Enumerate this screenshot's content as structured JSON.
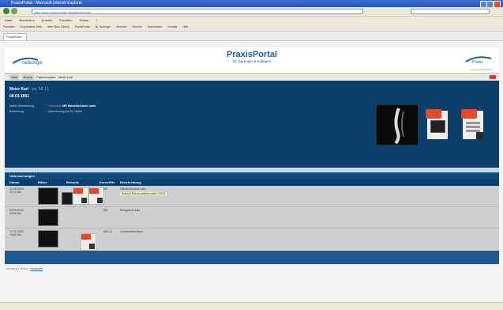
{
  "browser": {
    "title": "PraxisPortal - Microsoft Internet Explorer",
    "address": "http://www.praxisportal.de/patientenakte",
    "menu": [
      "Datei",
      "Bearbeiten",
      "Ansicht",
      "Favoriten",
      "Extras",
      "?"
    ],
    "favorites": [
      "Favoriten",
      "Empfohlene Sites",
      "Web Slice Gallery",
      "PraxisPortal",
      "Dr. Sprenger",
      "Befunde",
      "Termine",
      "Nachrichten",
      "Kontakt",
      "Hilfe"
    ],
    "tab_label": "PraxisPortal"
  },
  "header": {
    "logo_left": "radiologie",
    "title": "PraxisPortal",
    "subtitle": "Dr. Sprenger & Kollegen",
    "logo_right": "Praxis",
    "subline": "Gemeinschaftspraxis"
  },
  "breadcrumb": {
    "items": [
      "Start",
      "Suche"
    ],
    "current": "Patientenakte - Meier Karl"
  },
  "patient": {
    "name": "Meier Karl",
    "name_extra": "(m, 58 J.)",
    "dob": "08.03.1951",
    "rows": [
      {
        "label": "Aktive Überweisung",
        "red": "Orthopädie",
        "strong": "MR Halswirbelsäule nativ"
      },
      {
        "label": "Bemerkung",
        "red": "",
        "strong": "",
        "text": "Überweisung von Dr. Huber"
      }
    ]
  },
  "studies": {
    "section_title": "Untersuchungen",
    "columns": [
      "Datum",
      "Bilder",
      "Befunde",
      "Kennziffer",
      "Beschreibung"
    ],
    "rows": [
      {
        "date": "12.05.2009",
        "time": "10:14 Uhr",
        "code": "MR",
        "desc": "Halswirbelsäule nativ",
        "desc2": "Befund: Bandscheibenvorfall C5/C6",
        "icons": 2
      },
      {
        "date": "03.04.2009",
        "time": "08:30 Uhr",
        "code": "MR",
        "desc": "Kniegelenk links",
        "desc2": "",
        "icons": 0
      },
      {
        "date": "17.02.2009",
        "time": "14:05 Uhr",
        "code": "MR LS",
        "desc": "Lendenwirbelsäule",
        "desc2": "",
        "icons": 1
      }
    ]
  },
  "bottom": {
    "text": "Zurück zur Suche ·",
    "link": "Abmelden"
  },
  "colors": {
    "panel": "#0c3f6b",
    "accent": "#1c5fa3",
    "pdf_red": "#e14a2c"
  }
}
